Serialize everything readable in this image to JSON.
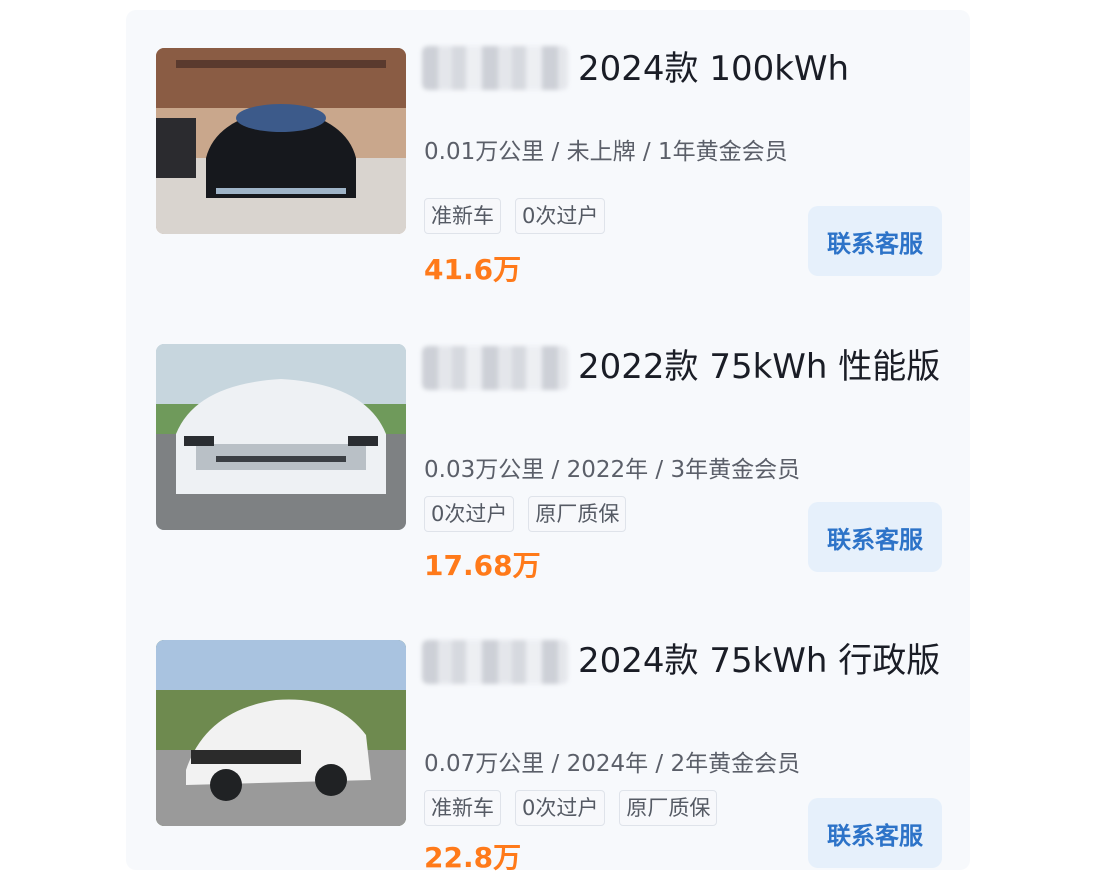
{
  "listings": [
    {
      "title": "2024款 100kWh",
      "meta": "0.01万公里 / 未上牌 / 1年黄金会员",
      "tags": [
        "准新车",
        "0次过户"
      ],
      "price": "41.6万",
      "cta": "联系客服"
    },
    {
      "title": "2022款 75kWh 性能版",
      "meta": "0.03万公里 / 2022年 / 3年黄金会员",
      "tags": [
        "0次过户",
        "原厂质保"
      ],
      "price": "17.68万",
      "cta": "联系客服"
    },
    {
      "title": "2024款 75kWh 行政版",
      "meta": "0.07万公里 / 2024年 / 2年黄金会员",
      "tags": [
        "准新车",
        "0次过户",
        "原厂质保"
      ],
      "price": "22.8万",
      "cta": "联系客服"
    }
  ]
}
